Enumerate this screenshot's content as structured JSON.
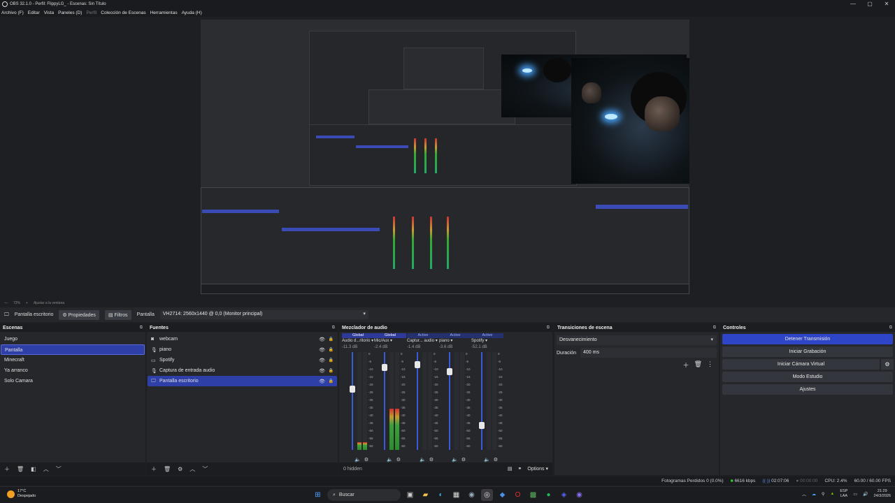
{
  "window": {
    "title": "OBS 32.1.0 - Perfil: FlippyLG_ - Escenas: Sin Título",
    "controls": [
      "—",
      "▢",
      "✕"
    ]
  },
  "menu": [
    "Archivo (F)",
    "Editar",
    "Vista",
    "Paneles (D)",
    "Perfil",
    "Colección de Escenas",
    "Herramientas",
    "Ayuda (H)"
  ],
  "zoom": {
    "value": "72%",
    "fit_label": "Ajustar a la ventana"
  },
  "source_toolbar": {
    "source_name": "Pantalla escritorio",
    "properties": "Propiedades",
    "filters": "Filtros",
    "display_label": "Pantalla",
    "display_value": "VH2714: 2560x1440 @ 0,0 (Monitor principal)"
  },
  "scenes": {
    "title": "Escenas",
    "items": [
      "Juego",
      "Pantalla",
      "Minecraft",
      "Ya arranco",
      "Solo Camara"
    ],
    "active_index": 1
  },
  "sources": {
    "title": "Fuentes",
    "items": [
      {
        "label": "webcam",
        "icon": "camera-icon"
      },
      {
        "label": "piano",
        "icon": "microphone-icon"
      },
      {
        "label": "Spotify",
        "icon": "window-icon"
      },
      {
        "label": "Captura de entrada audio",
        "icon": "microphone-icon"
      },
      {
        "label": "Pantalla escritorio",
        "icon": "monitor-icon"
      }
    ],
    "active_index": 4
  },
  "mixer": {
    "title": "Mezclador de audio",
    "channels": [
      {
        "badge": "Global",
        "name": "Audio d...ritorio",
        "db": "-11.3 dB",
        "level": 0.08,
        "volume": 0.63
      },
      {
        "badge": "Global",
        "name": "Mic/Aux",
        "db": "-2.4 dB",
        "level": 0.42,
        "volume": 0.87
      },
      {
        "badge": "Active",
        "name": "Captur... audio",
        "db": "-1.4 dB",
        "level": 0.0,
        "volume": 0.9
      },
      {
        "badge": "Active",
        "name": "piano",
        "db": "-3.6 dB",
        "level": 0.0,
        "volume": 0.82
      },
      {
        "badge": "Active",
        "name": "Spotify",
        "db": "-52.1 dB",
        "level": 0.0,
        "volume": 0.23
      }
    ],
    "scale": [
      "0",
      "-5",
      "-10",
      "-15",
      "-20",
      "-25",
      "-30",
      "-35",
      "-40",
      "-45",
      "-50",
      "-55",
      "-60"
    ],
    "hidden": "0 hidden",
    "options": "Options"
  },
  "transitions": {
    "title": "Transiciones de escena",
    "selected": "Desvanecimiento",
    "duration_label": "Duración",
    "duration_value": "400 ms"
  },
  "controls": {
    "title": "Controles",
    "stop_stream": "Detener Transmisión",
    "start_recording": "Iniciar Grabación",
    "virtual_camera": "Iniciar Cámara Virtual",
    "studio_mode": "Modo Estudio",
    "settings": "Ajustes"
  },
  "status": {
    "dropped": "Fotogramas Perdidos 0 (0.0%)",
    "bitrate": "6616 kbps",
    "stream_time": "02:07:06",
    "rec_time": "00:00:00",
    "cpu": "CPU: 2.4%",
    "fps": "60.00 / 60.00 FPS"
  },
  "taskbar": {
    "temperature": "17°C",
    "weather": "Despejado",
    "search": "Buscar",
    "lang_1": "ESP",
    "lang_2": "LAA",
    "time": "21:29",
    "date": "24/3/2026"
  },
  "colors": {
    "accent": "#2f45c7",
    "selection": "#2f3fa8",
    "panel": "#25272b"
  }
}
